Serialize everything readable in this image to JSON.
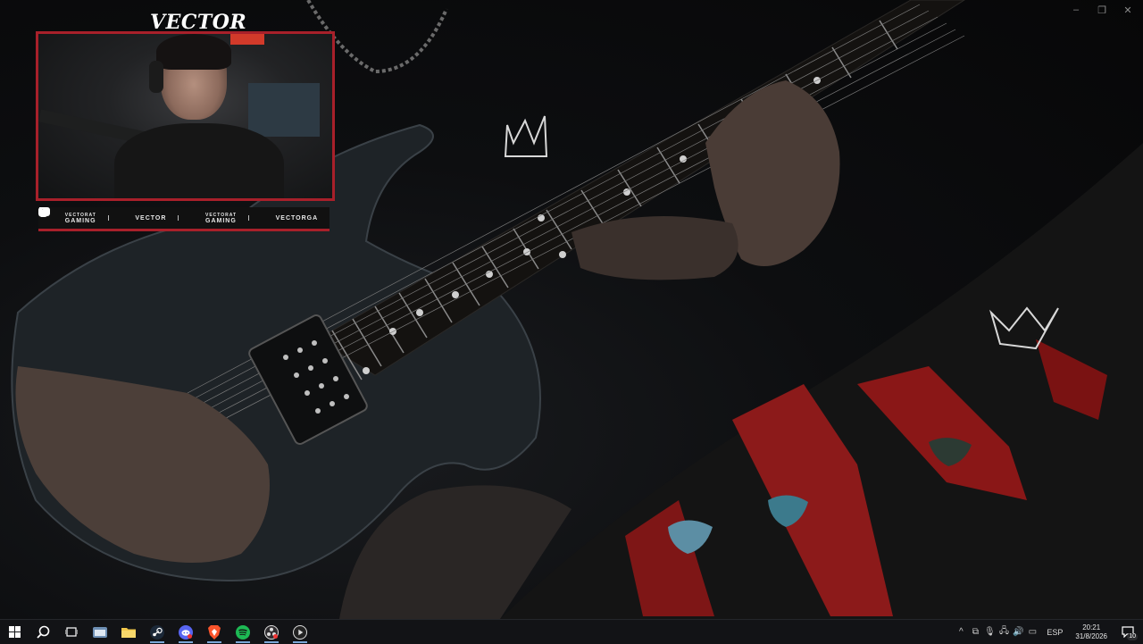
{
  "stream": {
    "cam_title": "VECTOR",
    "accent_color": "#a8202a",
    "socials": [
      {
        "icon": "youtube-icon",
        "label_line1": "VECTORAT",
        "label_line2": "GAMING"
      },
      {
        "icon": "twitch-icon",
        "label_line1": "VECTOR",
        "label_line2": ""
      },
      {
        "icon": "twitter-icon",
        "label_line1": "VECTORAT",
        "label_line2": "GAMING"
      },
      {
        "icon": "instagram-icon",
        "label_line1": "VECTORGA",
        "label_line2": ""
      }
    ]
  },
  "window_controls": [
    "minimize-icon",
    "restore-icon",
    "close-icon"
  ],
  "taskbar": {
    "apps": [
      {
        "name": "start",
        "icon": "windows-icon"
      },
      {
        "name": "search",
        "icon": "search-icon"
      },
      {
        "name": "task-view",
        "icon": "task-view-icon"
      },
      {
        "name": "file-explorer-alt",
        "icon": "explorer-icon"
      },
      {
        "name": "folder",
        "icon": "folder-icon"
      },
      {
        "name": "steam",
        "icon": "steam-icon"
      },
      {
        "name": "discord",
        "icon": "discord-icon"
      },
      {
        "name": "brave",
        "icon": "brave-icon"
      },
      {
        "name": "spotify",
        "icon": "spotify-icon"
      },
      {
        "name": "obs",
        "icon": "obs-icon"
      },
      {
        "name": "media-player",
        "icon": "media-player-icon"
      }
    ],
    "tray": {
      "language": "ESP",
      "time": "20:21",
      "date": "31/8/2026",
      "notifications": "10"
    }
  }
}
